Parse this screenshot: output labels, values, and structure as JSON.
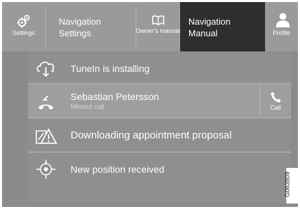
{
  "topbar": {
    "settings": {
      "label": "Settings",
      "icon": "gears-icon"
    },
    "navigation_settings": {
      "label": "Navigation\nSettings"
    },
    "owners_manual": {
      "label": "Owner's\nmanual",
      "icon": "open-book-icon"
    },
    "navigation_manual": {
      "label": "Navigation\nManual"
    },
    "profile": {
      "label": "Profile",
      "icon": "person-icon"
    }
  },
  "notifications": [
    {
      "title": "TuneIn is installing",
      "icon": "cloud-download-icon"
    },
    {
      "title": "Sebastian Petersson",
      "subtitle": "Missed call",
      "icon": "missed-call-icon",
      "action_label": "Call",
      "action_icon": "phone-icon"
    },
    {
      "title": "Downloading appointment proposal",
      "icon": "service-warning-icon"
    },
    {
      "title": "New position received",
      "icon": "position-crosshair-icon"
    }
  ],
  "image_code": "G063809",
  "colors": {
    "panel": "#8b8b8b",
    "topbar": "#9a9a9a",
    "active_tab": "#2e2e2e",
    "text": "#ffffff"
  }
}
